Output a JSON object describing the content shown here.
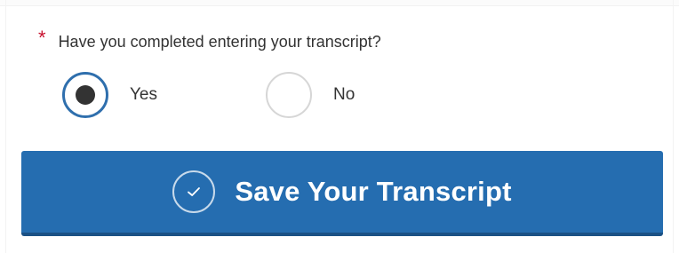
{
  "form": {
    "required_marker": "*",
    "question": "Have you completed entering your transcript?",
    "options": [
      {
        "label": "Yes",
        "selected": true
      },
      {
        "label": "No",
        "selected": false
      }
    ]
  },
  "button": {
    "label": "Save Your Transcript",
    "icon": "check-circle-icon"
  },
  "colors": {
    "primary": "#256db0",
    "required": "#c8102e",
    "radio_selected_border": "#2f6fad",
    "text": "#333333"
  }
}
